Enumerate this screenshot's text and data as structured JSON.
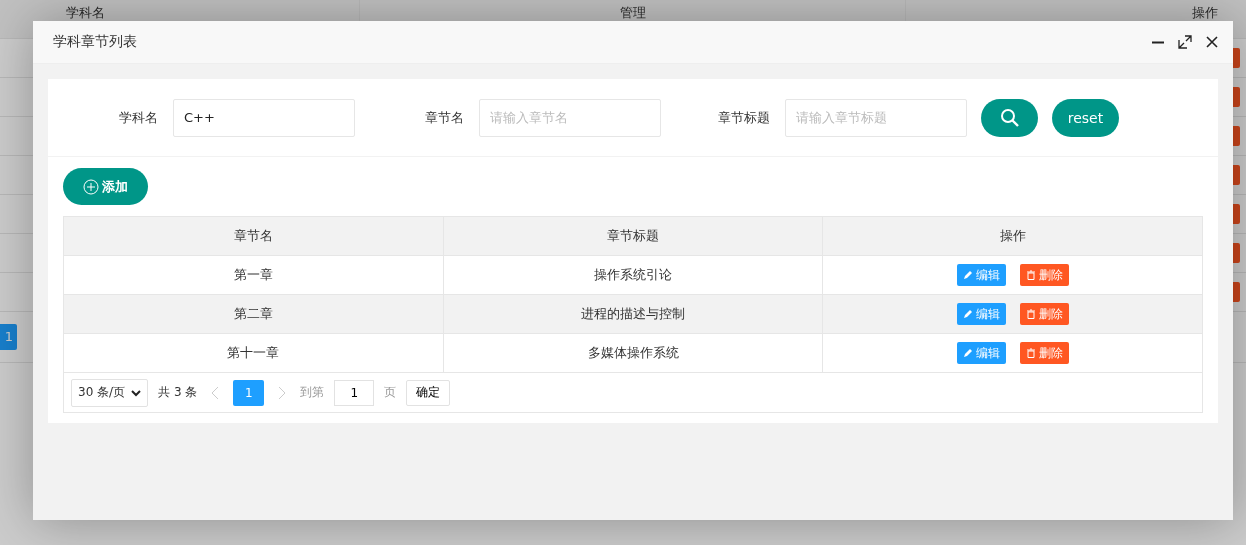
{
  "background": {
    "columns": [
      "学科名",
      "管理",
      "操作"
    ],
    "page": "1"
  },
  "dialog": {
    "title": "学科章节列表"
  },
  "search": {
    "fields": [
      {
        "label": "学科名",
        "value": "C++"
      },
      {
        "label": "章节名",
        "placeholder": "请输入章节名"
      },
      {
        "label": "章节标题",
        "placeholder": "请输入章节标题"
      }
    ],
    "reset": "reset"
  },
  "add_button": "添加",
  "table": {
    "columns": [
      "章节名",
      "章节标题",
      "操作"
    ],
    "rows": [
      {
        "chapter": "第一章",
        "title": "操作系统引论",
        "edit": "编辑",
        "delete": "删除"
      },
      {
        "chapter": "第二章",
        "title": "进程的描述与控制",
        "edit": "编辑",
        "delete": "删除"
      },
      {
        "chapter": "第十一章",
        "title": "多媒体操作系统",
        "edit": "编辑",
        "delete": "删除"
      }
    ]
  },
  "pagination": {
    "page_size": "30 条/页",
    "total": "共 3 条",
    "pages": [
      {
        "label": "1",
        "selected": true
      }
    ],
    "goto_label": "到第",
    "goto_value": "1",
    "page_unit": "页",
    "confirm": "确定"
  }
}
